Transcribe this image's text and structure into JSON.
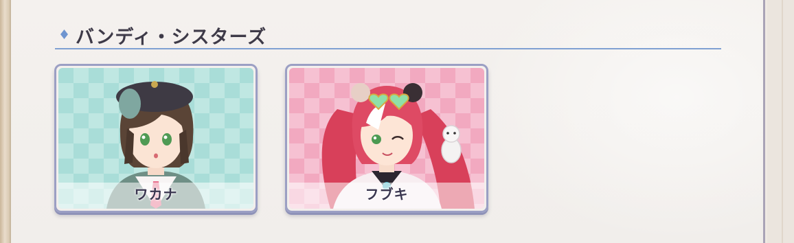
{
  "section": {
    "title": "バンディ・シスターズ",
    "accent_color": "#7fa0d2"
  },
  "characters": [
    {
      "name": "ワカナ",
      "card_theme": "teal",
      "background_color": "#a9ddd8",
      "portrait_icon": "character-portrait-wakana"
    },
    {
      "name": "フブキ",
      "card_theme": "pink",
      "background_color": "#f2a9c0",
      "portrait_icon": "character-portrait-fubuki"
    }
  ]
}
